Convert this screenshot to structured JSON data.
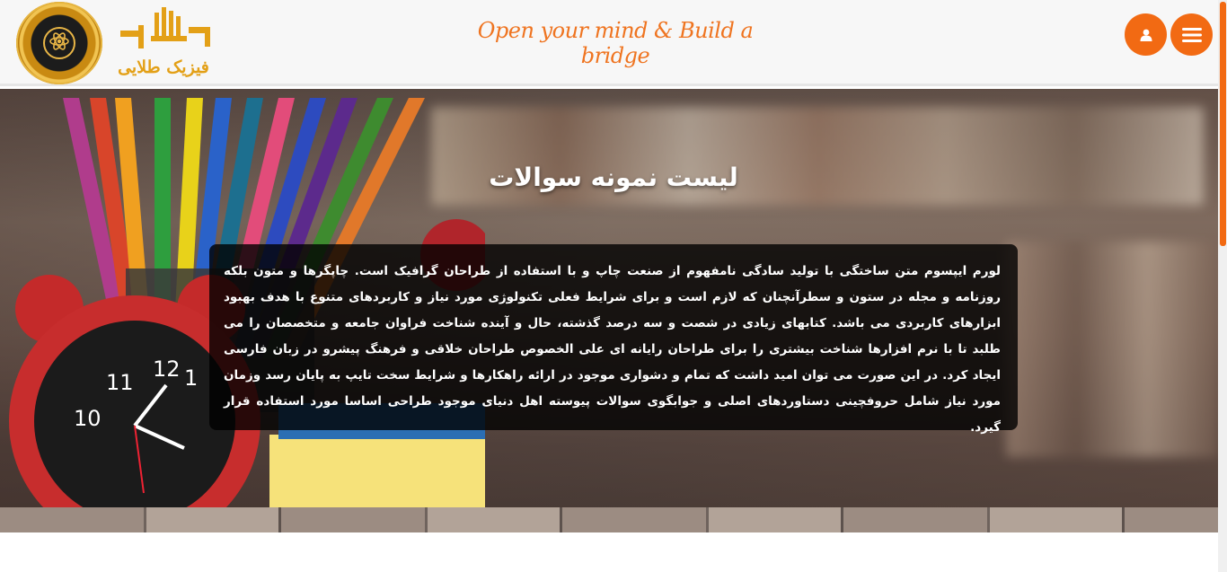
{
  "header": {
    "brand_name": "فیزیک طلایی",
    "slogan": "Open your mind & Build a bridge",
    "user_button_icon": "user-icon",
    "menu_button_icon": "hamburger-menu-icon",
    "accent_color": "#f26a13"
  },
  "hero": {
    "title": "لیست نمونه سوالات",
    "description": "لورم ایپسوم متن ساختگی با تولید سادگی نامفهوم از صنعت چاپ و با استفاده از طراحان گرافیک است. چاپگرها و متون بلکه روزنامه و مجله در ستون و سطرآنچنان که لازم است و برای شرایط فعلی تکنولوژی مورد نیاز و کاربردهای متنوع با هدف بهبود ابزارهای کاربردی می باشد. کتابهای زیادی در شصت و سه درصد گذشته، حال و آینده شناخت فراوان جامعه و متخصصان را می طلبد تا با نرم افزارها شناخت بیشتری را برای طراحان رایانه ای علی الخصوص طراحان خلاقی و فرهنگ پیشرو در زبان فارسی ایجاد کرد. در این صورت می توان امید داشت که تمام و دشواری موجود در ارائه راهکارها و شرایط سخت تایپ به پایان رسد وزمان مورد نیاز شامل حروفچینی دستاوردهای اصلی و جوابگوی سوالات پیوسته اهل دنیای موجود طراحی اساسا مورد استفاده قرار گیرد."
  }
}
